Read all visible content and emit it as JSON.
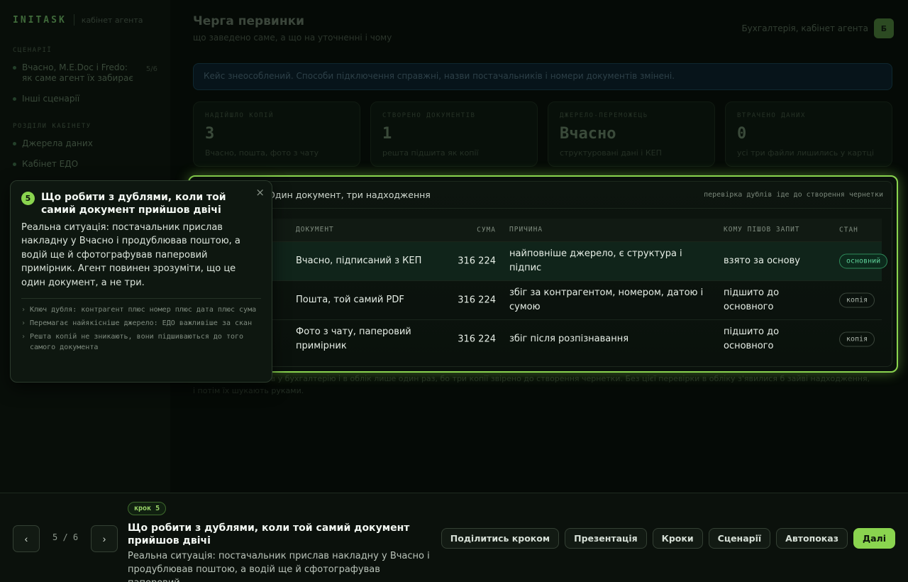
{
  "sidebar": {
    "logo": "INITASK",
    "subtitle": "кабінет агента",
    "section_scenarios": "СЦЕНАРІЇ",
    "scenario_items": [
      {
        "label": "Вчасно, M.E.Doc і Fredo: як саме агент їх забирає",
        "count": "5/6"
      },
      {
        "label": "Інші сценарії"
      }
    ],
    "section_office": "РОЗДІЛИ КАБІНЕТУ",
    "office_items": [
      {
        "label": "Джерела даних"
      },
      {
        "label": "Кабінет ЕДО"
      }
    ]
  },
  "header": {
    "title": "Черга первинки",
    "subtitle": "що заведено саме, а що на уточненні і чому",
    "role": "Бухгалтерія, кабінет агента",
    "avatar": "Б"
  },
  "banner": "Кейс знеособлений. Способи підключення справжні, назви постачальників і номери документів змінені.",
  "stats": [
    {
      "label": "НАДІЙШЛО КОПІЙ",
      "value": "3",
      "note": "Вчасно, пошта, фото з чату"
    },
    {
      "label": "СТВОРЕНО ДОКУМЕНТІВ",
      "value": "1",
      "note": "решта підшита як копії"
    },
    {
      "label": "ДЖЕРЕЛО-ПЕРЕМОЖЕЦЬ",
      "value": "Вчасно",
      "note": "структуровані дані і КЕП"
    },
    {
      "label": "ВТРАЧЕНО ДАНИХ",
      "value": "0",
      "note": "усі три файли лишились у картці"
    }
  ],
  "below_note": "...рахунок потрапив у бухгалтерію і в облік лише один раз, бо три копії звірено до створення чернетки. Без цієї перевірки в обліку з'явилися б зайві надходження, і потім їх шукають руками.",
  "card": {
    "title": "Один документ, три надходження",
    "hint": "перевірка дублів іде до створення чернетки",
    "columns": {
      "doc": "ДОКУМЕНТ",
      "sum": "СУМА",
      "reason": "ПРИЧИНА",
      "who": "КОМУ ПІШОВ ЗАПИТ",
      "state": "СТАН"
    },
    "rows": [
      {
        "doc": "Вчасно, підписаний з КЕП",
        "sum": "316 224",
        "reason": "найповніше джерело, є структура і підпис",
        "who": "взято за основу",
        "state": "основний",
        "main": true
      },
      {
        "doc": "Пошта, той самий PDF",
        "sum": "316 224",
        "reason": "збіг за контрагентом, номером, датою і сумою",
        "who": "підшито до основного",
        "state": "копія",
        "main": false
      },
      {
        "doc": "Фото з чату, паперовий примірник",
        "sum": "316 224",
        "reason": "збіг після розпізнавання",
        "who": "підшито до основного",
        "state": "копія",
        "main": false
      }
    ]
  },
  "popover": {
    "step": "5",
    "close": "×",
    "title": "Що робити з дублями, коли той самий документ прийшов двічі",
    "body": "Реальна ситуація: постачальник прислав накладну у Вчасно і продублював поштою, а водій ще й сфотографував паперовий примірник. Агент повинен зрозуміти, що це один документ, а не три.",
    "bullets": [
      "Ключ дубля: контрагент плюс номер плюс дата плюс сума",
      "Перемагає найякісніше джерело: ЕДО важливіше за скан",
      "Решта копій не зникають, вони підшиваються до того самого документа"
    ]
  },
  "stepbar": {
    "prev": "‹",
    "next": "›",
    "pager": "5 / 6",
    "badge": "крок 5",
    "title": "Що робити з дублями, коли той самий документ прийшов двічі",
    "desc": "Реальна ситуація: постачальник прислав накладну у Вчасно і продублював поштою, а водій ще й сфотографував паперовий...",
    "actions": {
      "share": "Поділитись кроком",
      "presentation": "Презентація",
      "steps": "Кроки",
      "scenarios": "Сценарії",
      "autoplay": "Автопоказ",
      "next": "Далі"
    }
  },
  "colors": {
    "accent": "#8ad44f",
    "main_state": "#5fd39a",
    "background": "#050a06"
  }
}
